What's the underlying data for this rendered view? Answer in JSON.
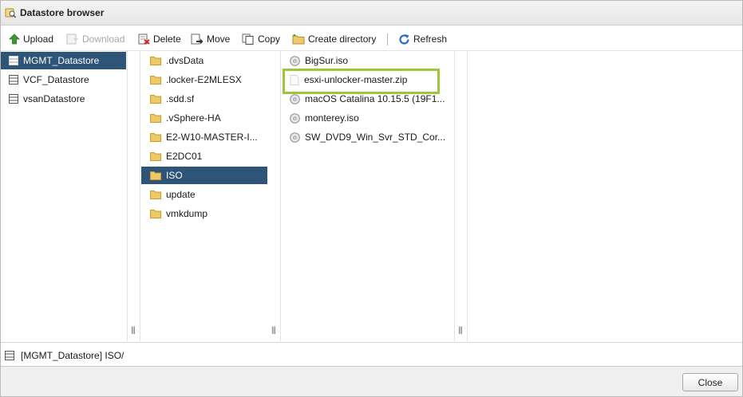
{
  "window": {
    "title": "Datastore browser"
  },
  "toolbar": {
    "upload": "Upload",
    "download": "Download",
    "delete": "Delete",
    "move": "Move",
    "copy": "Copy",
    "create_directory": "Create directory",
    "refresh": "Refresh"
  },
  "datastores": [
    {
      "label": "MGMT_Datastore",
      "selected": true
    },
    {
      "label": "VCF_Datastore",
      "selected": false
    },
    {
      "label": "vsanDatastore",
      "selected": false
    }
  ],
  "folders": [
    {
      "label": ".dvsData"
    },
    {
      "label": ".locker-E2MLESX"
    },
    {
      "label": ".sdd.sf"
    },
    {
      "label": ".vSphere-HA"
    },
    {
      "label": "E2-W10-MASTER-I..."
    },
    {
      "label": "E2DC01"
    },
    {
      "label": "ISO",
      "selected": true
    },
    {
      "label": "update"
    },
    {
      "label": "vmkdump"
    }
  ],
  "files": [
    {
      "label": "BigSur.iso",
      "icon": "disc-icon"
    },
    {
      "label": "esxi-unlocker-master.zip",
      "icon": "file-icon",
      "highlighted": true
    },
    {
      "label": "macOS Catalina 10.15.5 (19F1...",
      "icon": "disc-icon"
    },
    {
      "label": "monterey.iso",
      "icon": "disc-icon"
    },
    {
      "label": "SW_DVD9_Win_Svr_STD_Cor...",
      "icon": "disc-icon"
    }
  ],
  "status": {
    "path": "[MGMT_Datastore] ISO/"
  },
  "footer": {
    "close": "Close"
  },
  "colors": {
    "selection": "#2e5478",
    "highlight_border": "#9fc63a",
    "folder": "#e9c15a"
  }
}
